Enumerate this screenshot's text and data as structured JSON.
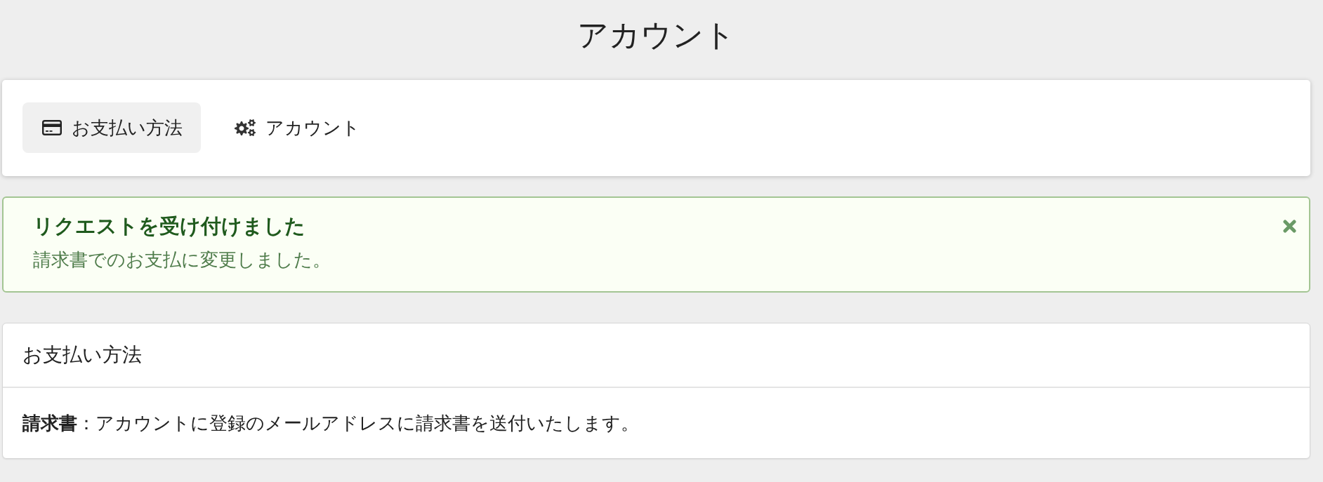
{
  "page": {
    "title": "アカウント"
  },
  "tabs": [
    {
      "label": "お支払い方法",
      "selected": true
    },
    {
      "label": "アカウント",
      "selected": false
    }
  ],
  "alert": {
    "title": "リクエストを受け付けました",
    "message": "請求書でのお支払に変更しました。"
  },
  "panel": {
    "title": "お支払い方法",
    "body": "**請求書**：アカウントに登録のメールアドレスに請求書を送付いたします。"
  }
}
